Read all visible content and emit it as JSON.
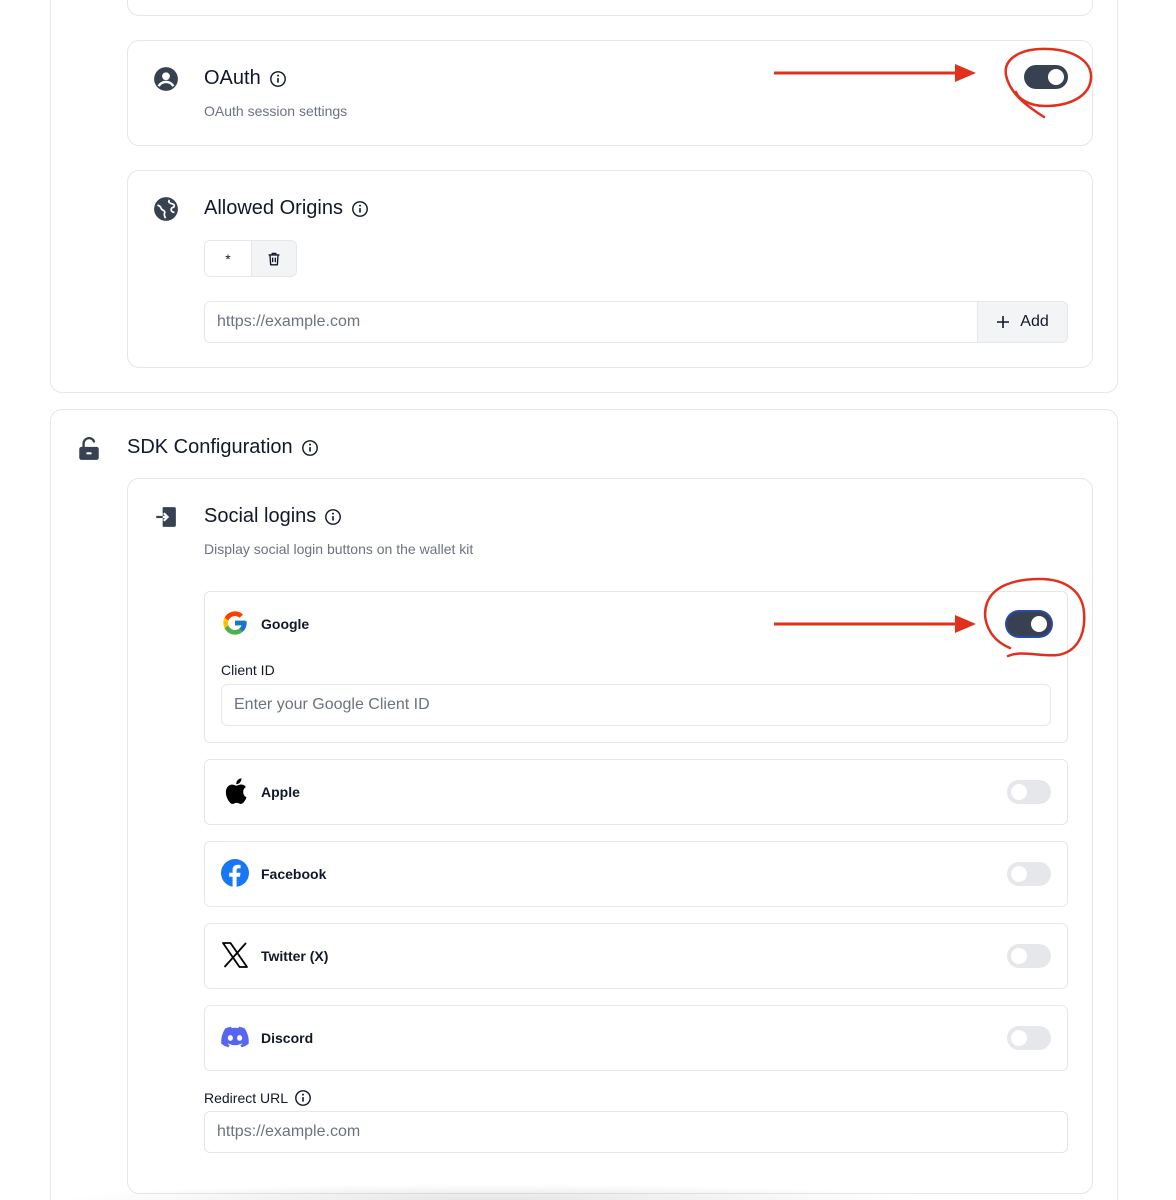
{
  "oauth": {
    "title": "OAuth",
    "description": "OAuth session settings",
    "toggle_on": true
  },
  "allowed_origins": {
    "title": "Allowed Origins",
    "origins": [
      "*"
    ],
    "input_placeholder": "https://example.com",
    "add_label": "Add"
  },
  "sdk": {
    "title": "SDK Configuration",
    "social_logins": {
      "title": "Social logins",
      "description": "Display social login buttons on the wallet kit",
      "providers": [
        {
          "label": "Google",
          "icon": "google-icon",
          "enabled": true
        },
        {
          "label": "Apple",
          "icon": "apple-icon",
          "enabled": false
        },
        {
          "label": "Facebook",
          "icon": "facebook-icon",
          "enabled": false
        },
        {
          "label": "Twitter (X)",
          "icon": "x-icon",
          "enabled": false
        },
        {
          "label": "Discord",
          "icon": "discord-icon",
          "enabled": false
        }
      ],
      "google_client_id_label": "Client ID",
      "google_client_id_placeholder": "Enter your Google Client ID",
      "redirect_url_label": "Redirect URL",
      "redirect_url_placeholder": "https://example.com"
    }
  },
  "colors": {
    "toggle_on": "#374151",
    "toggle_off": "#e5e7eb",
    "annotation_red": "#e0301e",
    "border": "#e5e7eb"
  }
}
